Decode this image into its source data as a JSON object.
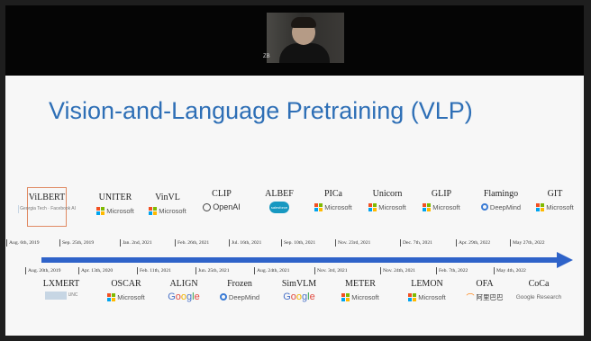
{
  "meeting": {
    "participant_name": "ZB"
  },
  "slide": {
    "title": "Vision-and-Language Pretraining (VLP)",
    "models": [
      {
        "name": "ViLBERT",
        "logo": "Georgia Tech · Facebook AI",
        "logo_type": "cite",
        "highlighted": true
      },
      {
        "name": "UNITER",
        "logo": "Microsoft",
        "logo_type": "microsoft"
      },
      {
        "name": "VinVL",
        "logo": "Microsoft",
        "logo_type": "microsoft"
      },
      {
        "name": "CLIP",
        "logo": "OpenAI",
        "logo_type": "openai"
      },
      {
        "name": "ALBEF",
        "logo": "salesforce",
        "logo_type": "salesforce"
      },
      {
        "name": "PICa",
        "logo": "Microsoft",
        "logo_type": "microsoft"
      },
      {
        "name": "Unicorn",
        "logo": "Microsoft",
        "logo_type": "microsoft"
      },
      {
        "name": "GLIP",
        "logo": "Microsoft",
        "logo_type": "microsoft"
      },
      {
        "name": "Flamingo",
        "logo": "DeepMind",
        "logo_type": "deepmind"
      },
      {
        "name": "GIT",
        "logo": "Microsoft",
        "logo_type": "microsoft"
      },
      {
        "name": "LXMERT",
        "logo": "UNC",
        "logo_type": "cite"
      },
      {
        "name": "OSCAR",
        "logo": "Microsoft",
        "logo_type": "microsoft"
      },
      {
        "name": "ALIGN",
        "logo": "Google",
        "logo_type": "google"
      },
      {
        "name": "Frozen",
        "logo": "DeepMind",
        "logo_type": "deepmind"
      },
      {
        "name": "SimVLM",
        "logo": "Google",
        "logo_type": "google"
      },
      {
        "name": "METER",
        "logo": "Microsoft",
        "logo_type": "microsoft"
      },
      {
        "name": "LEMON",
        "logo": "Microsoft",
        "logo_type": "microsoft"
      },
      {
        "name": "OFA",
        "logo": "阿里巴巴",
        "logo_type": "alibaba"
      },
      {
        "name": "CoCa",
        "logo": "Google Research",
        "logo_type": "google-research"
      }
    ],
    "dates": [
      "Aug. 6th, 2019",
      "Sep. 25th, 2019",
      "Jan. 2nd, 2021",
      "Feb. 26th, 2021",
      "Jul. 16th, 2021",
      "Sep. 10th, 2021",
      "Nov. 23rd, 2021",
      "Dec. 7th, 2021",
      "Apr. 29th, 2022",
      "May 27th, 2022",
      "Aug. 20th, 2019",
      "Apr. 13th, 2020",
      "Feb. 11th, 2021",
      "Jun. 25th, 2021",
      "Aug. 24th, 2021",
      "Nov. 3rd, 2021",
      "Nov. 24th, 2021",
      "Feb. 7th, 2022",
      "May 4th, 2022"
    ]
  }
}
